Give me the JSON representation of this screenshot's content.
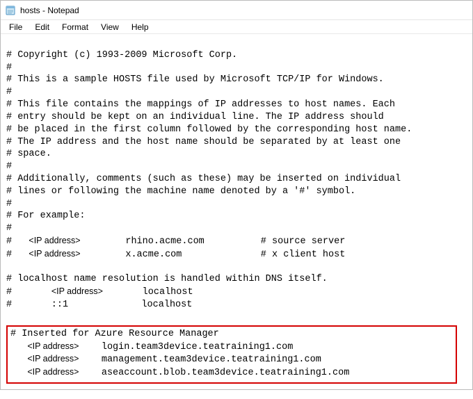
{
  "window": {
    "title": "hosts - Notepad"
  },
  "menu": {
    "file": "File",
    "edit": "Edit",
    "format": "Format",
    "view": "View",
    "help": "Help"
  },
  "lines": {
    "l01": "# Copyright (c) 1993-2009 Microsoft Corp.",
    "l02": "#",
    "l03": "# This is a sample HOSTS file used by Microsoft TCP/IP for Windows.",
    "l04": "#",
    "l05": "# This file contains the mappings of IP addresses to host names. Each",
    "l06": "# entry should be kept on an individual line. The IP address should",
    "l07": "# be placed in the first column followed by the corresponding host name.",
    "l08": "# The IP address and the host name should be separated by at least one",
    "l09": "# space.",
    "l10": "#",
    "l11": "# Additionally, comments (such as these) may be inserted on individual",
    "l12": "# lines or following the machine name denoted by a '#' symbol.",
    "l13": "#",
    "l14": "# For example:",
    "l15": "#",
    "ex1_prefix": "#   ",
    "ex1_ip": "<IP address>",
    "ex1_rest": "        rhino.acme.com          # source server",
    "ex2_prefix": "#   ",
    "ex2_ip": "<IP address>",
    "ex2_rest": "        x.acme.com              # x client host",
    "l18": "",
    "l19": "# localhost name resolution is handled within DNS itself.",
    "lh1_prefix": "#       ",
    "lh1_ip": "<IP address>",
    "lh1_rest": "       localhost",
    "lh2": "#       ::1             localhost",
    "l22": "",
    "hl_head": "# Inserted for Azure Resource Manager",
    "hl1_prefix": "   ",
    "hl1_ip": "<IP address>",
    "hl1_rest": "    login.team3device.teatraining1.com",
    "hl2_prefix": "   ",
    "hl2_ip": "<IP address>",
    "hl2_rest": "    management.team3device.teatraining1.com",
    "hl3_prefix": "   ",
    "hl3_ip": "<IP address>",
    "hl3_rest": "    aseaccount.blob.team3device.teatraining1.com"
  }
}
